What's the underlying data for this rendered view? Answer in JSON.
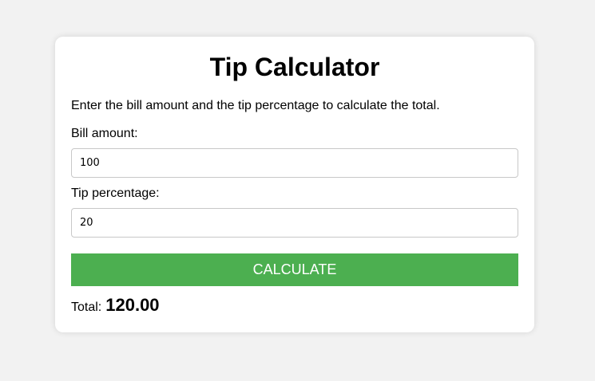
{
  "app": {
    "title": "Tip Calculator",
    "description": "Enter the bill amount and the tip percentage to calculate the total."
  },
  "form": {
    "bill_label": "Bill amount:",
    "bill_value": "100",
    "tip_label": "Tip percentage:",
    "tip_value": "20",
    "calculate_label": "CALCULATE"
  },
  "result": {
    "total_label": "Total:",
    "total_value": "120.00"
  },
  "colors": {
    "background": "#f2f2f2",
    "card": "#ffffff",
    "button": "#4caf50",
    "button_text": "#ffffff"
  }
}
